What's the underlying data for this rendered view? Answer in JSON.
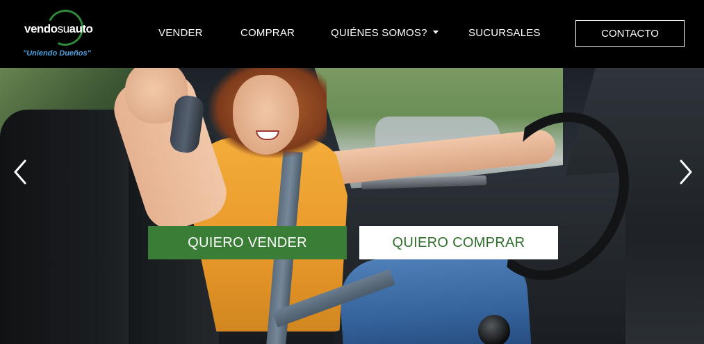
{
  "brand": {
    "name_part1": "vendo",
    "name_part2": "su",
    "name_part3": "auto",
    "tagline": "\"Uniendo Dueños\"",
    "ring_color": "#2e8b3a",
    "tagline_color": "#4fa3e0"
  },
  "nav": {
    "items": [
      {
        "label": "VENDER"
      },
      {
        "label": "COMPRAR"
      },
      {
        "label": "QUIÉNES SOMOS?",
        "has_dropdown": true
      },
      {
        "label": "SUCURSALES"
      }
    ],
    "contact_label": "CONTACTO"
  },
  "hero": {
    "icons": {
      "prev": "chevron-left-icon",
      "next": "chevron-right-icon"
    },
    "cta_sell": {
      "label": "QUIERO VENDER",
      "bg_color": "#3a7d36",
      "text_color": "#ffffff"
    },
    "cta_buy": {
      "label": "QUIERO COMPRAR",
      "bg_color": "#ffffff",
      "text_color": "#2f6e2b"
    }
  }
}
